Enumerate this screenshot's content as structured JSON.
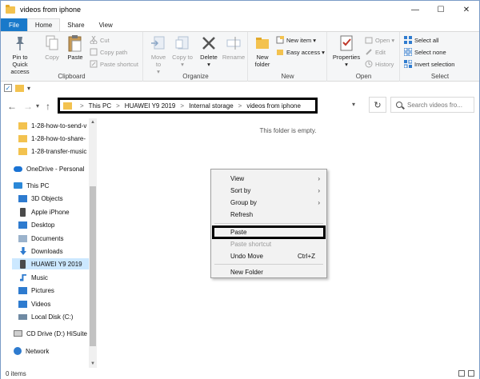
{
  "window": {
    "title": "videos from iphone",
    "controls": {
      "minimize": "—",
      "maximize": "☐",
      "close": "✕"
    }
  },
  "ribbon_tabs": [
    "File",
    "Home",
    "Share",
    "View"
  ],
  "ribbon": {
    "clipboard": {
      "label": "Clipboard",
      "pin": "Pin to Quick access",
      "copy": "Copy",
      "paste": "Paste",
      "cut": "Cut",
      "copy_path": "Copy path",
      "paste_shortcut": "Paste shortcut"
    },
    "organize": {
      "label": "Organize",
      "move_to": "Move to",
      "copy_to": "Copy to",
      "delete": "Delete",
      "rename": "Rename"
    },
    "new": {
      "label": "New",
      "new_folder": "New folder",
      "new_item": "New item",
      "easy_access": "Easy access"
    },
    "open": {
      "label": "Open",
      "properties": "Properties",
      "open": "Open",
      "edit": "Edit",
      "history": "History"
    },
    "select": {
      "label": "Select",
      "select_all": "Select all",
      "select_none": "Select none",
      "invert": "Invert selection"
    }
  },
  "address": {
    "crumbs": [
      "This PC",
      "HUAWEI Y9 2019",
      "Internal storage",
      "videos from iphone"
    ],
    "separator": ">",
    "search_placeholder": "Search videos fro..."
  },
  "nav_pane": {
    "items": [
      {
        "label": "1-28-how-to-send-v",
        "icon": "folder-icon"
      },
      {
        "label": "1-28-how-to-share-",
        "icon": "folder-icon"
      },
      {
        "label": "1-28-transfer-music",
        "icon": "folder-icon"
      },
      {
        "label": "OneDrive - Personal",
        "icon": "cloud-icon"
      },
      {
        "label": "This PC",
        "icon": "pc-icon"
      },
      {
        "label": "3D Objects",
        "icon": "folder-icon"
      },
      {
        "label": "Apple iPhone",
        "icon": "phone-icon"
      },
      {
        "label": "Desktop",
        "icon": "desktop-icon"
      },
      {
        "label": "Documents",
        "icon": "folder-icon"
      },
      {
        "label": "Downloads",
        "icon": "download-icon"
      },
      {
        "label": "HUAWEI Y9 2019",
        "icon": "phone-icon"
      },
      {
        "label": "Music",
        "icon": "music-icon"
      },
      {
        "label": "Pictures",
        "icon": "folder-icon"
      },
      {
        "label": "Videos",
        "icon": "folder-icon"
      },
      {
        "label": "Local Disk (C:)",
        "icon": "disk-icon"
      },
      {
        "label": "CD Drive (D:) HiSuite",
        "icon": "cd-icon"
      },
      {
        "label": "Network",
        "icon": "network-icon"
      }
    ]
  },
  "content": {
    "empty_message": "This folder is empty."
  },
  "context_menu": {
    "items": [
      {
        "label": "View",
        "submenu": true
      },
      {
        "label": "Sort by",
        "submenu": true
      },
      {
        "label": "Group by",
        "submenu": true
      },
      {
        "label": "Refresh"
      },
      {
        "label": "Paste"
      },
      {
        "label": "Paste shortcut",
        "disabled": true
      },
      {
        "label": "Undo Move",
        "shortcut": "Ctrl+Z"
      },
      {
        "label": "New Folder"
      }
    ]
  },
  "status": {
    "items_count": "0 items"
  },
  "colors": {
    "accent": "#1979ca",
    "folder": "#f3c24f",
    "selection": "#cce8ff"
  }
}
